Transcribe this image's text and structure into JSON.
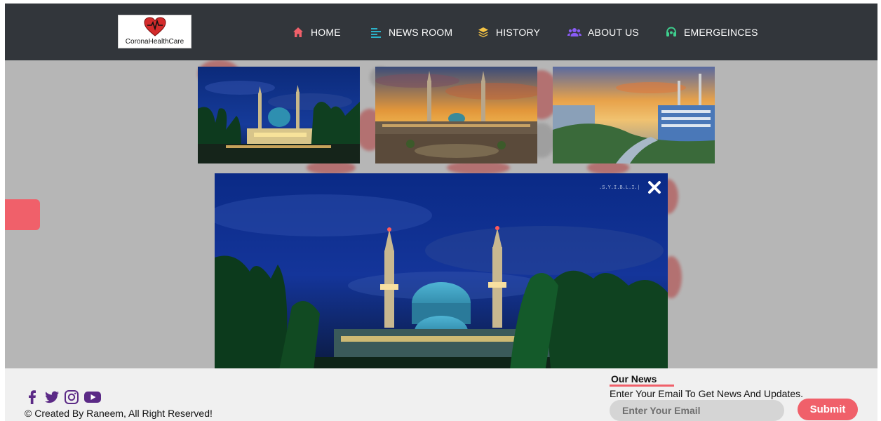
{
  "brand": {
    "name": "CoronaHealthCare",
    "accent": "#f0606a",
    "nav_bg": "#32363b"
  },
  "nav": {
    "items": [
      {
        "label": "HOME",
        "icon": "home-icon",
        "icon_color": "#f0606a"
      },
      {
        "label": "NEWS ROOM",
        "icon": "align-left-icon",
        "icon_color": "#2bb3c9"
      },
      {
        "label": "HISTORY",
        "icon": "layers-icon",
        "icon_color": "#f3c244"
      },
      {
        "label": "ABOUT US",
        "icon": "users-icon",
        "icon_color": "#8a5cf6"
      },
      {
        "label": "EMERGEINCES",
        "icon": "headset-icon",
        "icon_color": "#3ecf8e"
      }
    ]
  },
  "gallery": {
    "thumbnails": [
      {
        "alt": "mosque-night"
      },
      {
        "alt": "mosque-sunset-courtyard"
      },
      {
        "alt": "campus-sunset"
      }
    ],
    "lightbox": {
      "close_icon": "close-icon",
      "watermark": ".S.Y.I.B.L.I.|"
    }
  },
  "footer": {
    "social_icons": [
      "facebook-icon",
      "twitter-icon",
      "instagram-icon",
      "youtube-icon"
    ],
    "social_color": "#5b2a86",
    "copyright": "© Created By Raneem, All Right Reserved!",
    "newsletter": {
      "title": "Our News",
      "description": "Enter Your Email To Get News And Updates.",
      "email_placeholder": "Enter Your Email",
      "email_value": "",
      "submit_label": "Submit"
    }
  }
}
